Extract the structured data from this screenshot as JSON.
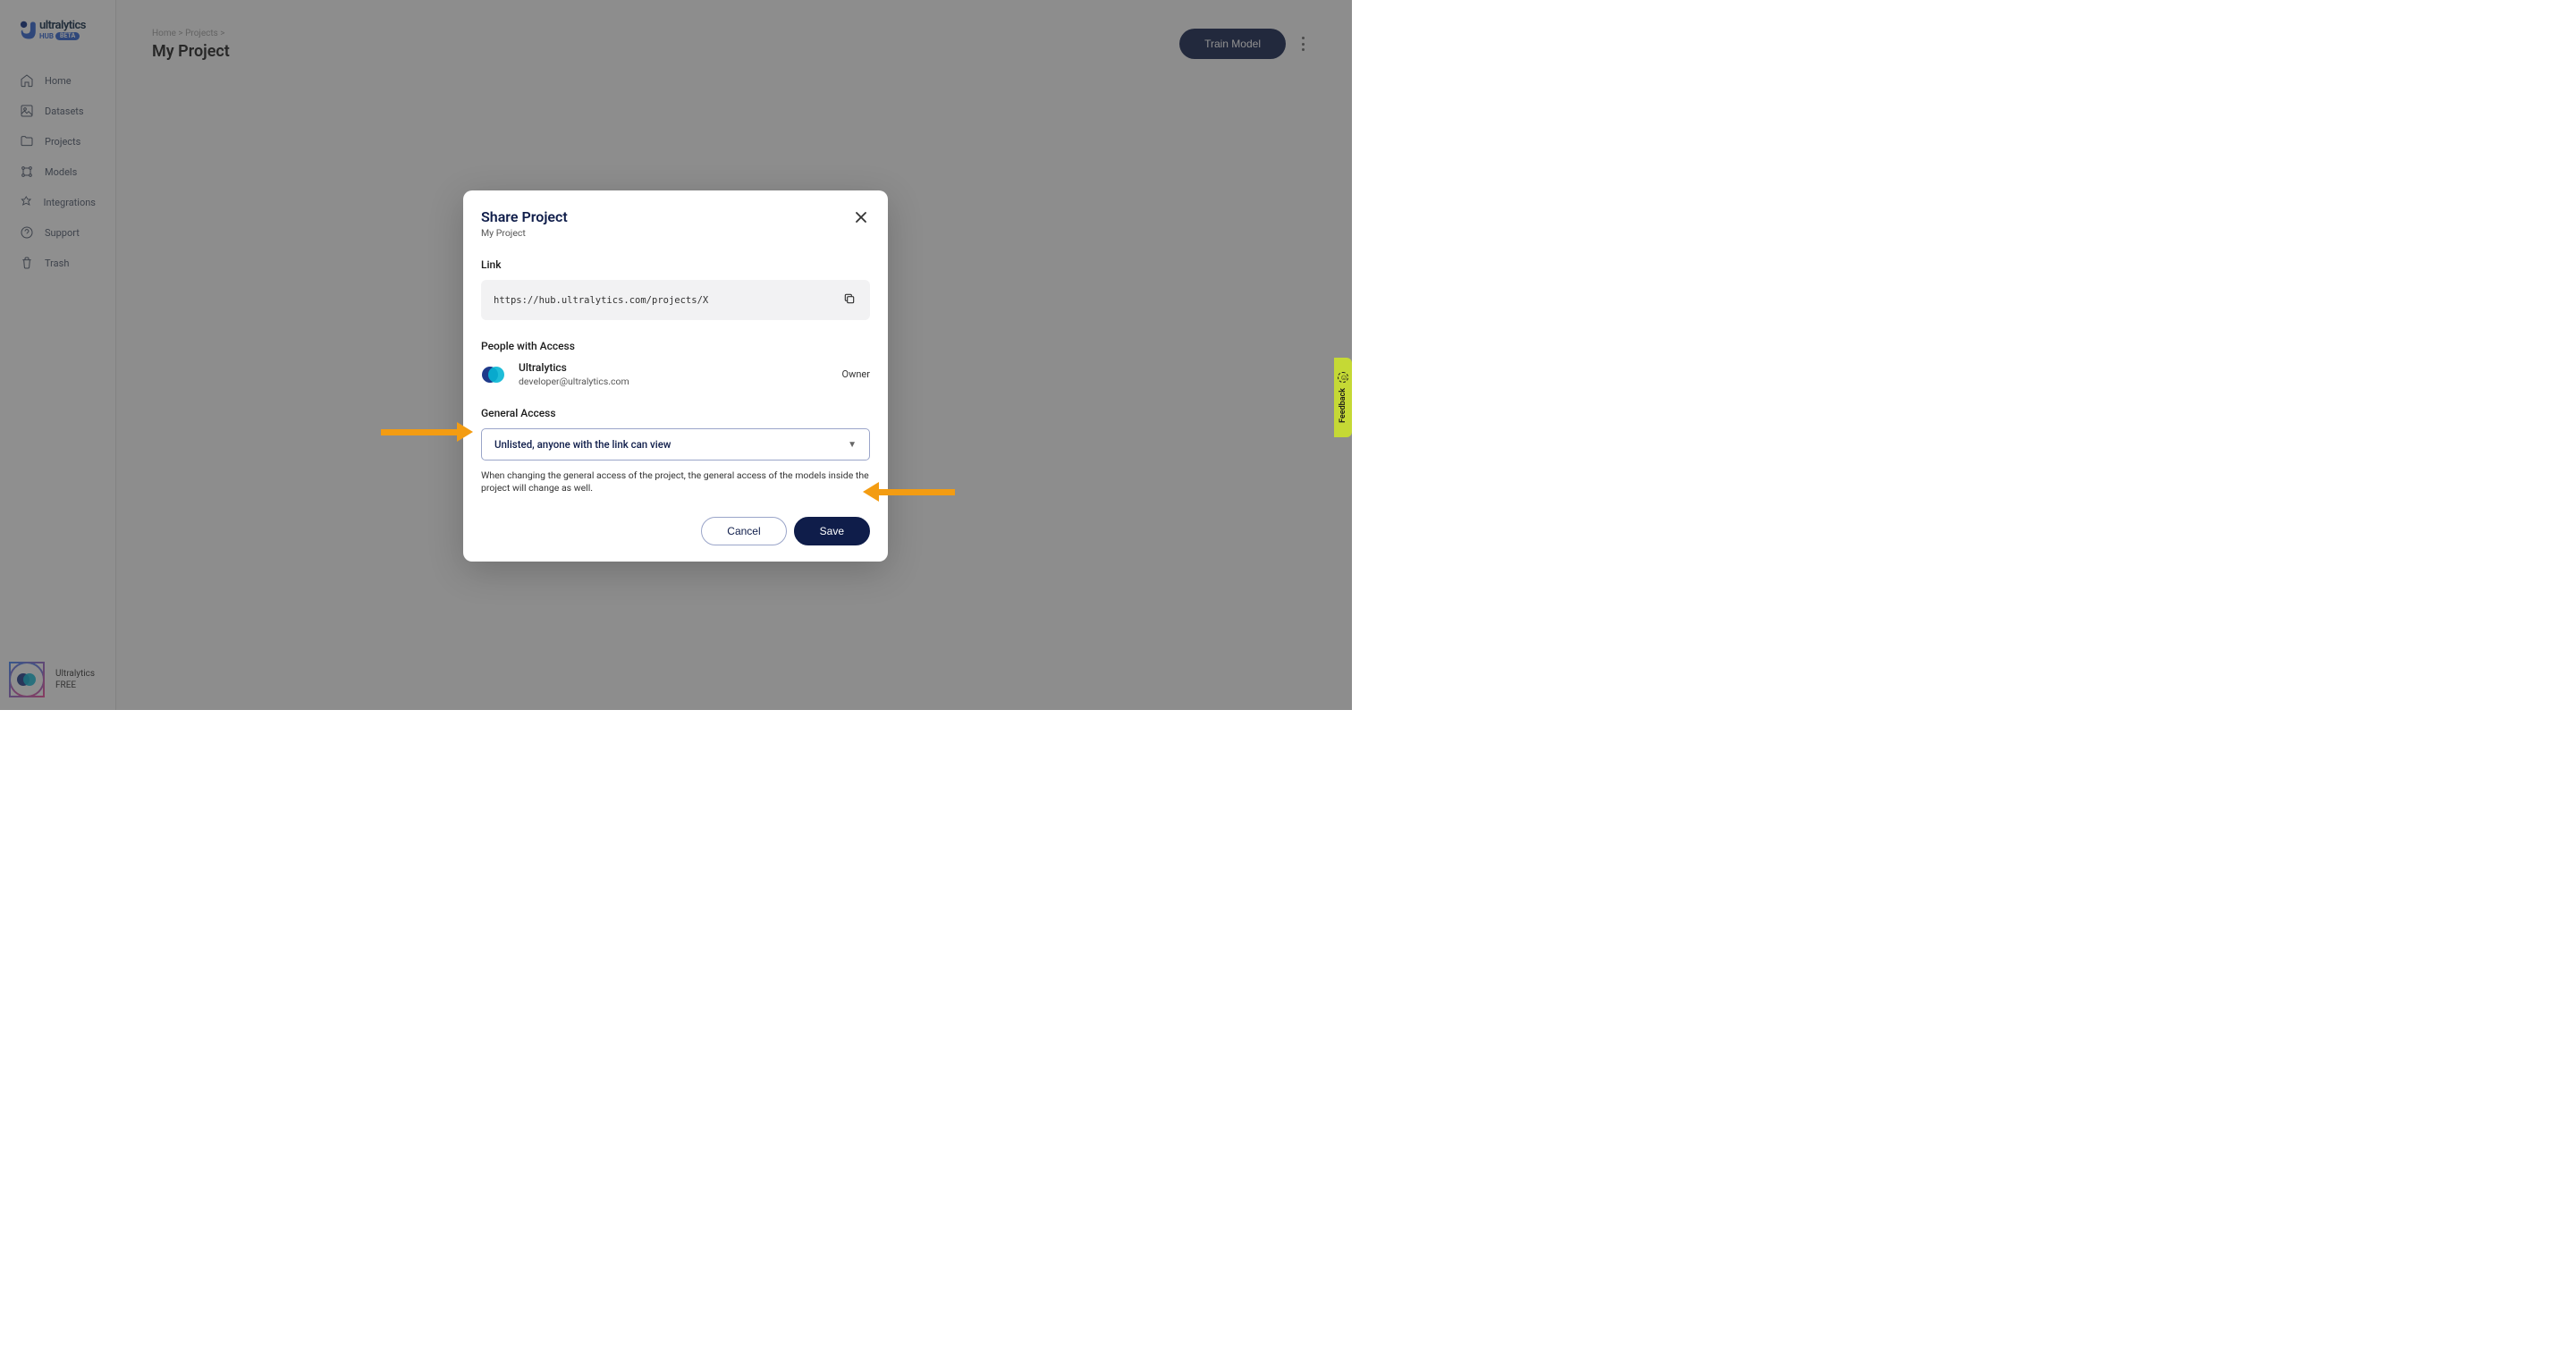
{
  "brand": {
    "name": "ultralytics",
    "sub": "HUB",
    "badge": "BETA"
  },
  "sidebar": {
    "items": [
      {
        "label": "Home"
      },
      {
        "label": "Datasets"
      },
      {
        "label": "Projects"
      },
      {
        "label": "Models"
      },
      {
        "label": "Integrations"
      },
      {
        "label": "Support"
      },
      {
        "label": "Trash"
      }
    ]
  },
  "user": {
    "name": "Ultralytics",
    "plan": "FREE"
  },
  "breadcrumb": {
    "home": "Home",
    "sep": ">",
    "projects": "Projects"
  },
  "page": {
    "title": "My Project",
    "train_button": "Train Model"
  },
  "modal": {
    "title": "Share Project",
    "subtitle": "My Project",
    "link_label": "Link",
    "link_value": "https://hub.ultralytics.com/projects/X",
    "people_label": "People with Access",
    "person": {
      "name": "Ultralytics",
      "email": "developer@ultralytics.com",
      "role": "Owner"
    },
    "general_label": "General Access",
    "general_selected": "Unlisted, anyone with the link can view",
    "help_text": "When changing the general access of the project, the general access of the models inside the project will change as well.",
    "cancel": "Cancel",
    "save": "Save"
  },
  "feedback": {
    "label": "Feedback"
  }
}
